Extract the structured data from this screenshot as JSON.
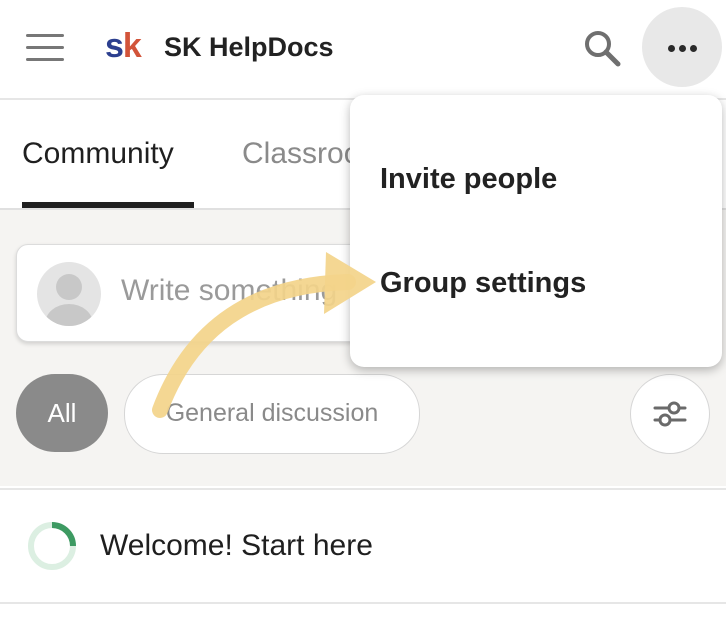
{
  "header": {
    "logo_letters": [
      "s",
      "k"
    ],
    "app_title": "SK HelpDocs",
    "search_icon": "search-icon",
    "menu_icon": "hamburger-icon",
    "more_icon": "more-horizontal-icon"
  },
  "tabs": [
    {
      "label": "Community",
      "active": true
    },
    {
      "label": "Classroom",
      "active": false
    }
  ],
  "composer": {
    "placeholder": "Write something"
  },
  "filters": {
    "chips": [
      {
        "label": "All",
        "selected": true
      },
      {
        "label": "General discussion",
        "selected": false
      }
    ],
    "filter_icon": "sliders-icon"
  },
  "feed_item": {
    "title": "Welcome! Start here",
    "progress": 0.25
  },
  "dropdown_menu": {
    "items": [
      {
        "label": "Invite people"
      },
      {
        "label": "Group settings"
      }
    ]
  },
  "colors": {
    "logo_s": "#2c3f8f",
    "logo_k": "#d2543a",
    "progress": "#3d9a62",
    "arrow": "#f3d48a",
    "chip_selected": "#8a8a8a"
  }
}
